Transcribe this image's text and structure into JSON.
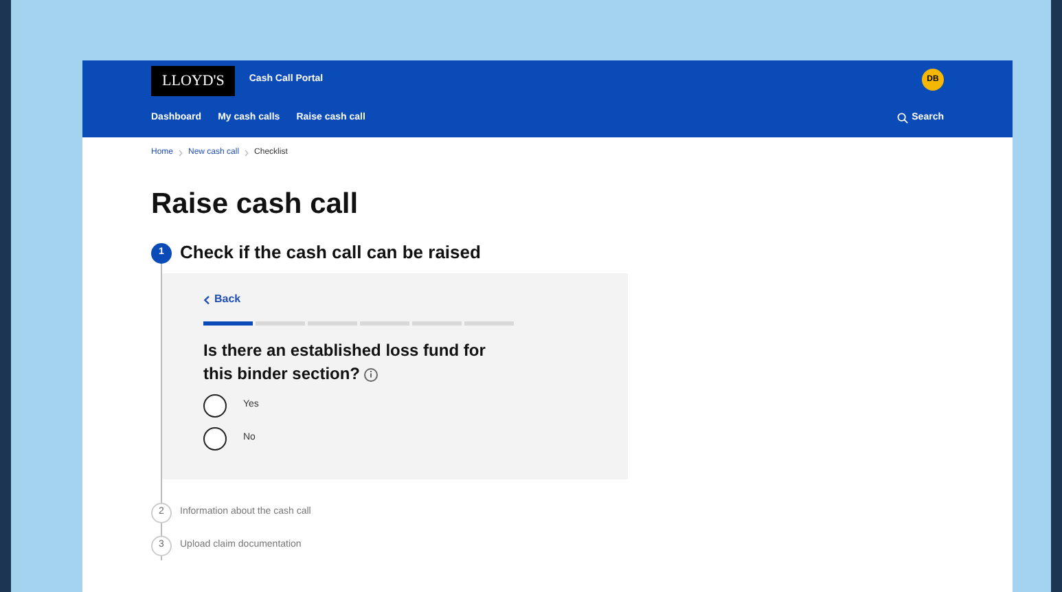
{
  "header": {
    "logo": "LLOYD'S",
    "portal_title": "Cash Call Portal",
    "avatar": "DB"
  },
  "nav": {
    "items": [
      {
        "label": "Dashboard"
      },
      {
        "label": "My cash calls"
      },
      {
        "label": "Raise cash call"
      }
    ],
    "search": "Search"
  },
  "breadcrumb": [
    {
      "label": "Home",
      "kind": "link"
    },
    {
      "label": "New cash call",
      "kind": "link"
    },
    {
      "label": "Checklist",
      "kind": "current"
    }
  ],
  "title": "Raise cash call",
  "steps": [
    {
      "number": "1",
      "label": "Check if the cash call can be raised",
      "active": true
    },
    {
      "number": "2",
      "label": "Information about the cash call",
      "active": false
    },
    {
      "number": "3",
      "label": "Upload claim documentation",
      "active": false
    }
  ],
  "card": {
    "back": "Back",
    "progress_segments": [
      {
        "done": true
      },
      {
        "done": false
      },
      {
        "done": false
      },
      {
        "done": false
      },
      {
        "done": false
      },
      {
        "done": false
      }
    ],
    "question": "Is there an established loss fund for this binder section?",
    "options": [
      {
        "label": "Yes",
        "selected": false
      },
      {
        "label": "No",
        "selected": false
      }
    ]
  }
}
